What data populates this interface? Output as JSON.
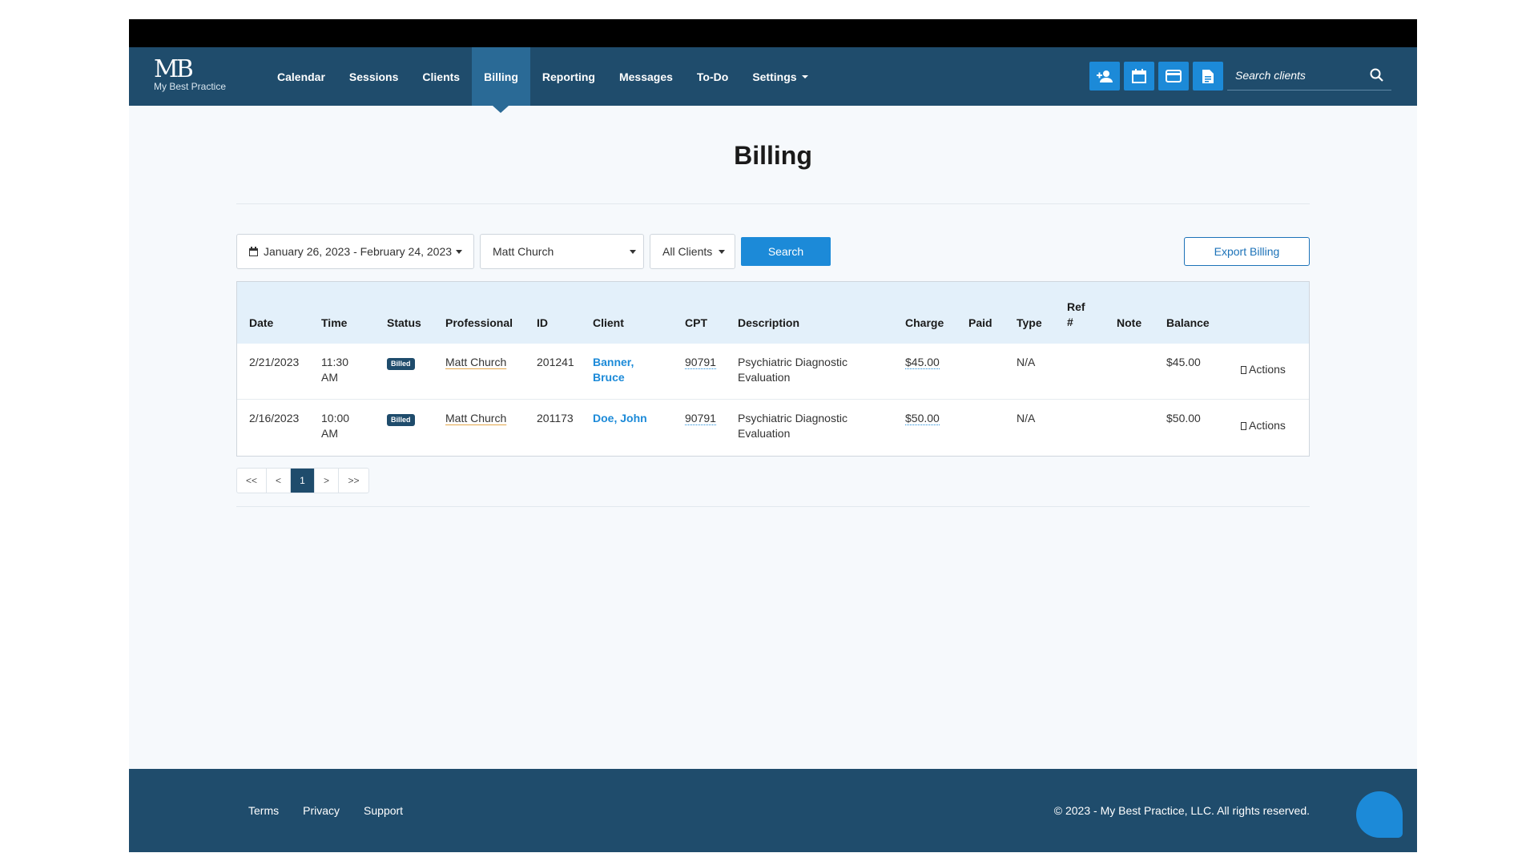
{
  "logo": {
    "mark": "MB",
    "name": "My Best Practice"
  },
  "nav": {
    "items": [
      {
        "label": "Calendar"
      },
      {
        "label": "Sessions"
      },
      {
        "label": "Clients"
      },
      {
        "label": "Billing",
        "active": true
      },
      {
        "label": "Reporting"
      },
      {
        "label": "Messages"
      },
      {
        "label": "To-Do"
      },
      {
        "label": "Settings",
        "dropdown": true
      }
    ],
    "icons": [
      "add-client-icon",
      "calendar-icon",
      "credit-card-icon",
      "document-icon"
    ],
    "search_placeholder": "Search clients"
  },
  "page": {
    "title": "Billing"
  },
  "filters": {
    "date_range": "January 26, 2023 - February 24, 2023",
    "professional": "Matt Church",
    "clients": "All Clients",
    "search_label": "Search",
    "export_label": "Export Billing"
  },
  "table": {
    "headers": {
      "date": "Date",
      "time": "Time",
      "status": "Status",
      "professional": "Professional",
      "id": "ID",
      "client": "Client",
      "cpt": "CPT",
      "description": "Description",
      "charge": "Charge",
      "paid": "Paid",
      "type": "Type",
      "ref": "Ref #",
      "note": "Note",
      "balance": "Balance"
    },
    "rows": [
      {
        "date": "2/21/2023",
        "time": "11:30 AM",
        "status": "Billed",
        "professional": "Matt Church",
        "id": "201241",
        "client": "Banner, Bruce",
        "cpt": "90791",
        "description": "Psychiatric Diagnostic Evaluation",
        "charge": "$45.00",
        "paid": "",
        "type": "N/A",
        "ref": "",
        "note": "",
        "balance": "$45.00",
        "actions": "Actions"
      },
      {
        "date": "2/16/2023",
        "time": "10:00 AM",
        "status": "Billed",
        "professional": "Matt Church",
        "id": "201173",
        "client": "Doe, John",
        "cpt": "90791",
        "description": "Psychiatric Diagnostic Evaluation",
        "charge": "$50.00",
        "paid": "",
        "type": "N/A",
        "ref": "",
        "note": "",
        "balance": "$50.00",
        "actions": "Actions"
      }
    ]
  },
  "pagination": {
    "first": "<<",
    "prev": "<",
    "current": "1",
    "next": ">",
    "last": ">>"
  },
  "footer": {
    "links": [
      "Terms",
      "Privacy",
      "Support"
    ],
    "copyright": "© 2023 - My Best Practice, LLC. All rights reserved."
  },
  "colors": {
    "navy": "#1f4c6c",
    "accent": "#1c8ad8",
    "active_nav": "#2a6a96"
  }
}
